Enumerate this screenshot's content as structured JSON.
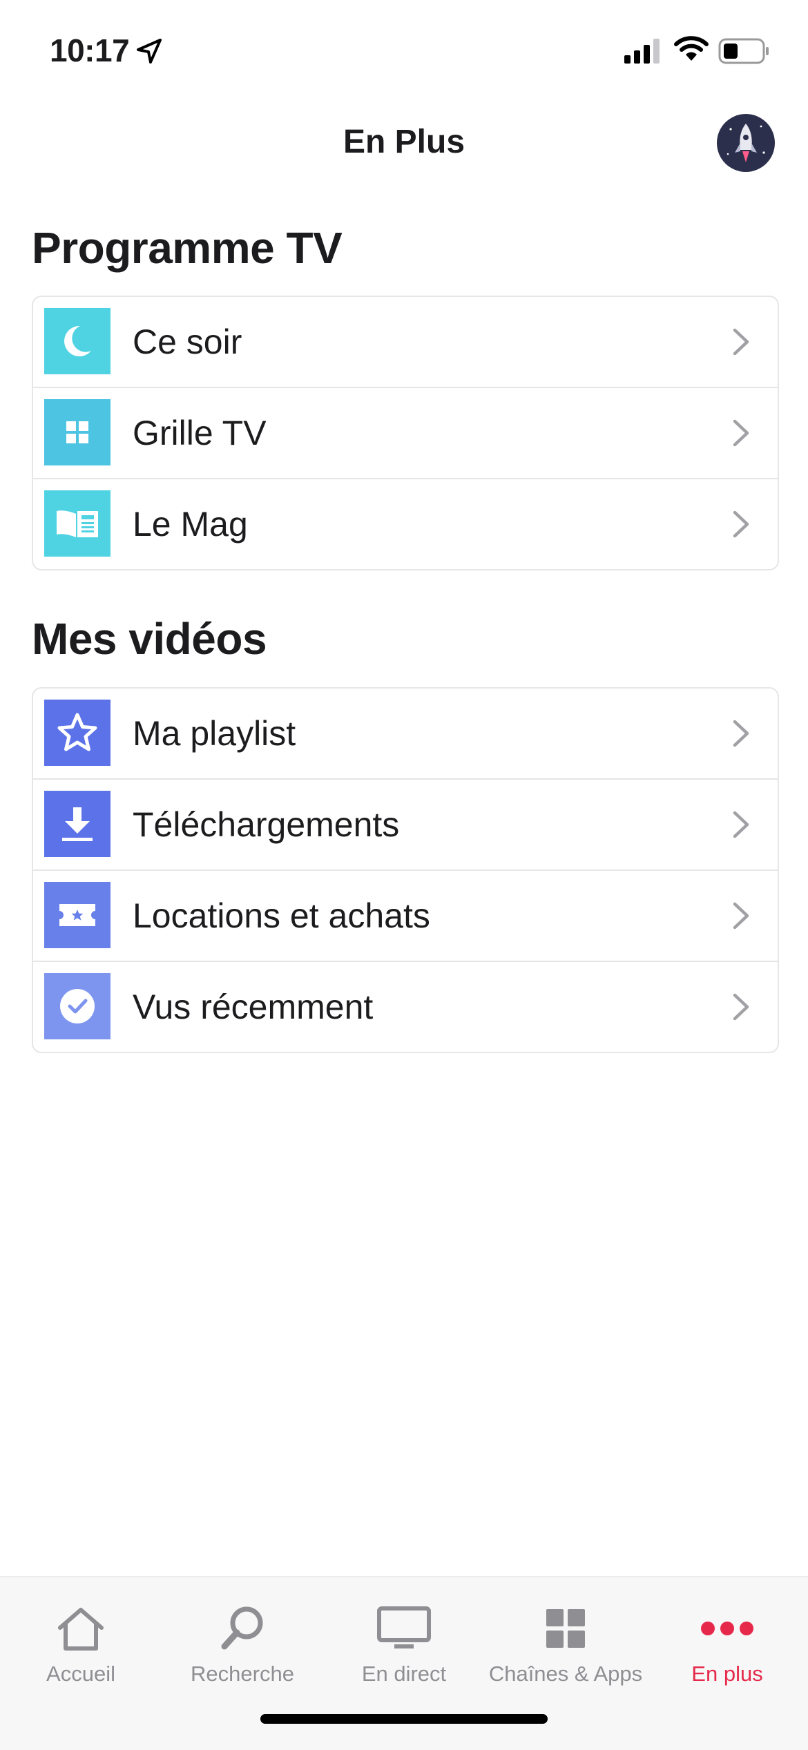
{
  "status_bar": {
    "time": "10:17"
  },
  "header": {
    "title": "En Plus"
  },
  "sections": [
    {
      "title": "Programme TV",
      "items": [
        {
          "label": "Ce soir",
          "icon": "moon-icon",
          "color": "#4fd3e3"
        },
        {
          "label": "Grille TV",
          "icon": "grid-icon",
          "color": "#4cc4e2"
        },
        {
          "label": "Le Mag",
          "icon": "magazine-icon",
          "color": "#4fd3e3"
        }
      ]
    },
    {
      "title": "Mes vidéos",
      "items": [
        {
          "label": "Ma playlist",
          "icon": "star-icon",
          "color": "#5b72e8"
        },
        {
          "label": "Téléchargements",
          "icon": "download-icon",
          "color": "#5b72e8"
        },
        {
          "label": "Locations et achats",
          "icon": "ticket-icon",
          "color": "#6880ea"
        },
        {
          "label": "Vus récemment",
          "icon": "check-circle-icon",
          "color": "#7d95ee"
        }
      ]
    }
  ],
  "tab_bar": {
    "tabs": [
      {
        "label": "Accueil",
        "icon": "home-icon"
      },
      {
        "label": "Recherche",
        "icon": "search-icon"
      },
      {
        "label": "En direct",
        "icon": "tv-icon"
      },
      {
        "label": "Chaînes & Apps",
        "icon": "apps-grid-icon"
      },
      {
        "label": "En plus",
        "icon": "more-dots-icon",
        "active": true
      }
    ],
    "active_color": "#e6294b",
    "inactive_color": "#8e8e93"
  }
}
